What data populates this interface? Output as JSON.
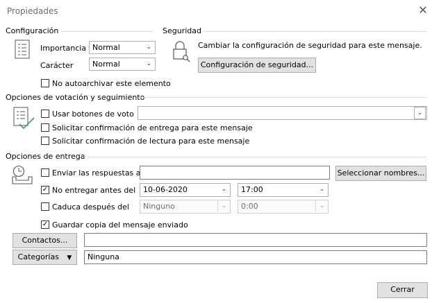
{
  "window": {
    "title": "Propiedades",
    "close_glyph": "✕"
  },
  "config": {
    "header": "Configuración",
    "importance_label": "Importancia",
    "importance_value": "Normal",
    "sensitivity_label": "Carácter",
    "sensitivity_value": "Normal",
    "no_autoarchive": {
      "label": "No autoarchivar este elemento",
      "checked": false
    }
  },
  "security": {
    "header": "Seguridad",
    "text": "Cambiar la configuración de seguridad para este mensaje.",
    "button": "Configuración de seguridad..."
  },
  "voting": {
    "header": "Opciones de votación y seguimiento",
    "use_voting": {
      "label": "Usar botones de voto",
      "checked": false,
      "value": ""
    },
    "delivery_receipt": {
      "label": "Solicitar confirmación de entrega para este mensaje",
      "checked": false
    },
    "read_receipt": {
      "label": "Solicitar confirmación de lectura para este mensaje",
      "checked": false
    }
  },
  "delivery": {
    "header": "Opciones de entrega",
    "replies_to": {
      "label": "Enviar las respuestas a",
      "checked": false,
      "value": ""
    },
    "select_names_button": "Seleccionar nombres...",
    "do_not_deliver": {
      "label": "No entregar antes del",
      "checked": true,
      "date": "10-06-2020",
      "time": "17:00"
    },
    "expires": {
      "label": "Caduca después del",
      "checked": false,
      "date": "Ninguno",
      "time": "0:00"
    },
    "save_copy": {
      "label": "Guardar copia del mensaje enviado",
      "checked": true
    }
  },
  "contacts": {
    "button": "Contactos...",
    "value": ""
  },
  "categories": {
    "button": "Categorías",
    "value": "Ninguna"
  },
  "close_button": "Cerrar",
  "check_glyph": "✓",
  "arrow_glyph": "⌄"
}
